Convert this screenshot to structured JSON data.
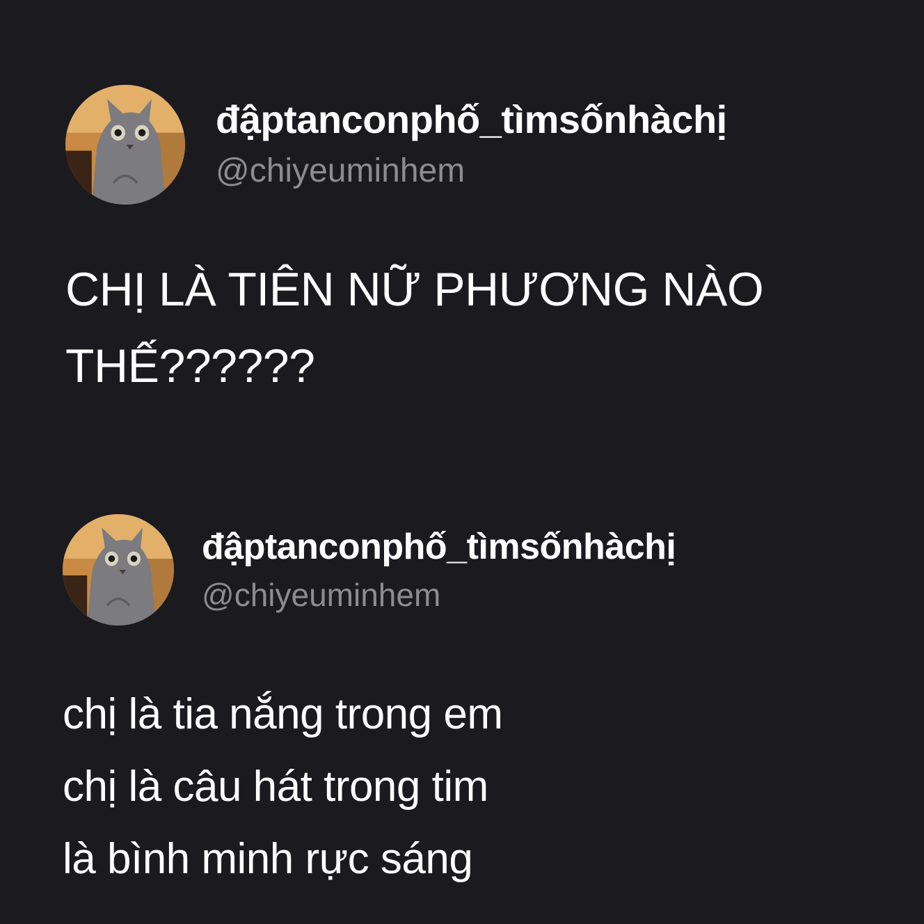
{
  "colors": {
    "background": "#1b1a1f",
    "text_primary": "#ffffff",
    "text_secondary": "#8d8c91"
  },
  "posts": [
    {
      "avatar_icon": "cat-avatar",
      "display_name": "đậptanconphố_tìmsốnhàchị",
      "handle": "@chiyeuminhem",
      "lines": [
        "CHỊ LÀ TIÊN NỮ PHƯƠNG NÀO",
        "THẾ??????"
      ]
    },
    {
      "avatar_icon": "cat-avatar",
      "display_name": "đậptanconphố_tìmsốnhàchị",
      "handle": "@chiyeuminhem",
      "lines": [
        "chị là tia nắng trong em",
        "chị là câu hát trong tim",
        "là bình minh rực sáng"
      ]
    }
  ]
}
